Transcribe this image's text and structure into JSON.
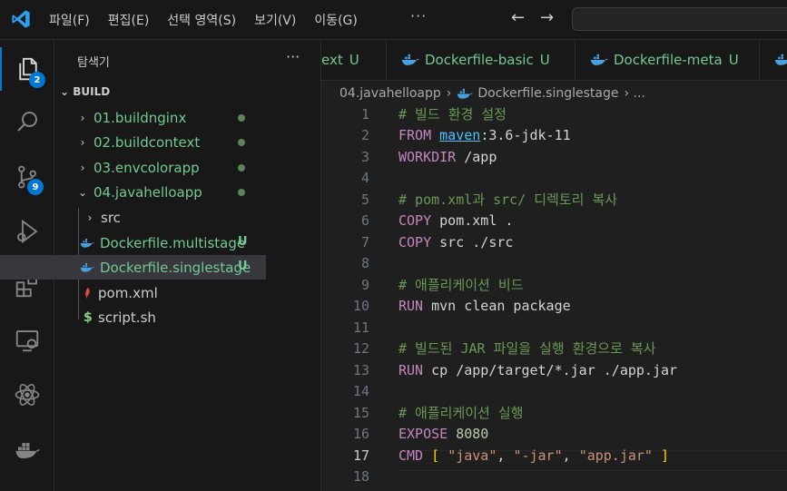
{
  "titlebar": {
    "menu": [
      "파일(F)",
      "편집(E)",
      "선택 영역(S)",
      "보기(V)",
      "이동(G)"
    ],
    "more": "···",
    "back": "←",
    "forward": "→"
  },
  "activity": {
    "explorer_badge": "2",
    "scm_badge": "9"
  },
  "sidebar": {
    "title": "탐색기",
    "more": "···",
    "section": "BUILD",
    "items": [
      {
        "label": "01.buildnginx",
        "chev": "›"
      },
      {
        "label": "02.buildcontext",
        "chev": "›"
      },
      {
        "label": "03.envcolorapp",
        "chev": "›"
      },
      {
        "label": "04.javahelloapp",
        "chev": "⌄"
      },
      {
        "label": "src",
        "chev": "›"
      },
      {
        "label": "Dockerfile.multistage",
        "status": "U"
      },
      {
        "label": "Dockerfile.singlestage",
        "status": "U"
      },
      {
        "label": "pom.xml"
      },
      {
        "label": "script.sh",
        "icon": "$"
      }
    ]
  },
  "tabs": [
    {
      "label": "ext",
      "status": "U"
    },
    {
      "label": "Dockerfile-basic",
      "status": "U"
    },
    {
      "label": "Dockerfile-meta",
      "status": "U"
    }
  ],
  "breadcrumb": {
    "folder": "04.javahelloapp",
    "sep1": "›",
    "file": "Dockerfile.singlestage",
    "sep2": "› ..."
  },
  "editor": {
    "current_line": 17,
    "lines": [
      {
        "n": "1",
        "tokens": [
          {
            "t": "# 빌드 환경 설정",
            "c": "comment"
          }
        ]
      },
      {
        "n": "2",
        "tokens": [
          {
            "t": "FROM ",
            "c": "keyword"
          },
          {
            "t": "maven",
            "c": "image"
          },
          {
            "t": ":3.6-jdk-11",
            "c": "text"
          }
        ]
      },
      {
        "n": "3",
        "tokens": [
          {
            "t": "WORKDIR ",
            "c": "keyword"
          },
          {
            "t": "/app",
            "c": "text"
          }
        ]
      },
      {
        "n": "4",
        "tokens": []
      },
      {
        "n": "5",
        "tokens": [
          {
            "t": "# pom.xml과 src/ 디렉토리 복사",
            "c": "comment"
          }
        ]
      },
      {
        "n": "6",
        "tokens": [
          {
            "t": "COPY ",
            "c": "keyword"
          },
          {
            "t": "pom.xml .",
            "c": "text"
          }
        ]
      },
      {
        "n": "7",
        "tokens": [
          {
            "t": "COPY ",
            "c": "keyword"
          },
          {
            "t": "src ./src",
            "c": "text"
          }
        ]
      },
      {
        "n": "8",
        "tokens": []
      },
      {
        "n": "9",
        "tokens": [
          {
            "t": "# 애플리케이션 비드",
            "c": "comment"
          }
        ]
      },
      {
        "n": "10",
        "tokens": [
          {
            "t": "RUN ",
            "c": "keyword"
          },
          {
            "t": "mvn clean package",
            "c": "text"
          }
        ]
      },
      {
        "n": "11",
        "tokens": []
      },
      {
        "n": "12",
        "tokens": [
          {
            "t": "# 빌드된 JAR 파일을 실행 환경으로 복사",
            "c": "comment"
          }
        ]
      },
      {
        "n": "13",
        "tokens": [
          {
            "t": "RUN ",
            "c": "keyword"
          },
          {
            "t": "cp /app/target/*.jar ./app.jar",
            "c": "text"
          }
        ]
      },
      {
        "n": "14",
        "tokens": []
      },
      {
        "n": "15",
        "tokens": [
          {
            "t": "# 애플리케이션 실행",
            "c": "comment"
          }
        ]
      },
      {
        "n": "16",
        "tokens": [
          {
            "t": "EXPOSE ",
            "c": "keyword"
          },
          {
            "t": "8080",
            "c": "number"
          }
        ]
      },
      {
        "n": "17",
        "tokens": [
          {
            "t": "CMD ",
            "c": "keyword"
          },
          {
            "t": "[ ",
            "c": "bracket"
          },
          {
            "t": "\"java\"",
            "c": "string"
          },
          {
            "t": ", ",
            "c": "text"
          },
          {
            "t": "\"-jar\"",
            "c": "string"
          },
          {
            "t": ", ",
            "c": "text"
          },
          {
            "t": "\"app.jar\"",
            "c": "string"
          },
          {
            "t": " ]",
            "c": "bracket"
          }
        ]
      },
      {
        "n": "18",
        "tokens": []
      }
    ]
  },
  "colors": {
    "accent": "#0078d4",
    "untracked": "#73c991",
    "keyword": "#c586c0",
    "comment": "#6a9955",
    "string": "#ce9178"
  }
}
